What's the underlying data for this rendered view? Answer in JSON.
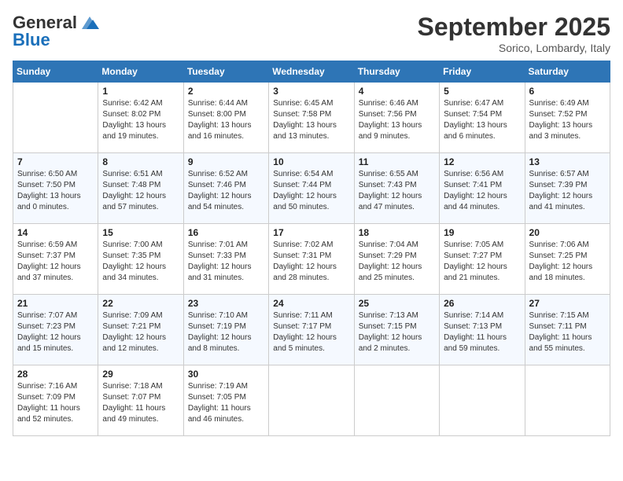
{
  "header": {
    "logo_line1": "General",
    "logo_line2": "Blue",
    "month_title": "September 2025",
    "subtitle": "Sorico, Lombardy, Italy"
  },
  "weekdays": [
    "Sunday",
    "Monday",
    "Tuesday",
    "Wednesday",
    "Thursday",
    "Friday",
    "Saturday"
  ],
  "weeks": [
    [
      {
        "day": "",
        "info": ""
      },
      {
        "day": "1",
        "info": "Sunrise: 6:42 AM\nSunset: 8:02 PM\nDaylight: 13 hours\nand 19 minutes."
      },
      {
        "day": "2",
        "info": "Sunrise: 6:44 AM\nSunset: 8:00 PM\nDaylight: 13 hours\nand 16 minutes."
      },
      {
        "day": "3",
        "info": "Sunrise: 6:45 AM\nSunset: 7:58 PM\nDaylight: 13 hours\nand 13 minutes."
      },
      {
        "day": "4",
        "info": "Sunrise: 6:46 AM\nSunset: 7:56 PM\nDaylight: 13 hours\nand 9 minutes."
      },
      {
        "day": "5",
        "info": "Sunrise: 6:47 AM\nSunset: 7:54 PM\nDaylight: 13 hours\nand 6 minutes."
      },
      {
        "day": "6",
        "info": "Sunrise: 6:49 AM\nSunset: 7:52 PM\nDaylight: 13 hours\nand 3 minutes."
      }
    ],
    [
      {
        "day": "7",
        "info": "Sunrise: 6:50 AM\nSunset: 7:50 PM\nDaylight: 13 hours\nand 0 minutes."
      },
      {
        "day": "8",
        "info": "Sunrise: 6:51 AM\nSunset: 7:48 PM\nDaylight: 12 hours\nand 57 minutes."
      },
      {
        "day": "9",
        "info": "Sunrise: 6:52 AM\nSunset: 7:46 PM\nDaylight: 12 hours\nand 54 minutes."
      },
      {
        "day": "10",
        "info": "Sunrise: 6:54 AM\nSunset: 7:44 PM\nDaylight: 12 hours\nand 50 minutes."
      },
      {
        "day": "11",
        "info": "Sunrise: 6:55 AM\nSunset: 7:43 PM\nDaylight: 12 hours\nand 47 minutes."
      },
      {
        "day": "12",
        "info": "Sunrise: 6:56 AM\nSunset: 7:41 PM\nDaylight: 12 hours\nand 44 minutes."
      },
      {
        "day": "13",
        "info": "Sunrise: 6:57 AM\nSunset: 7:39 PM\nDaylight: 12 hours\nand 41 minutes."
      }
    ],
    [
      {
        "day": "14",
        "info": "Sunrise: 6:59 AM\nSunset: 7:37 PM\nDaylight: 12 hours\nand 37 minutes."
      },
      {
        "day": "15",
        "info": "Sunrise: 7:00 AM\nSunset: 7:35 PM\nDaylight: 12 hours\nand 34 minutes."
      },
      {
        "day": "16",
        "info": "Sunrise: 7:01 AM\nSunset: 7:33 PM\nDaylight: 12 hours\nand 31 minutes."
      },
      {
        "day": "17",
        "info": "Sunrise: 7:02 AM\nSunset: 7:31 PM\nDaylight: 12 hours\nand 28 minutes."
      },
      {
        "day": "18",
        "info": "Sunrise: 7:04 AM\nSunset: 7:29 PM\nDaylight: 12 hours\nand 25 minutes."
      },
      {
        "day": "19",
        "info": "Sunrise: 7:05 AM\nSunset: 7:27 PM\nDaylight: 12 hours\nand 21 minutes."
      },
      {
        "day": "20",
        "info": "Sunrise: 7:06 AM\nSunset: 7:25 PM\nDaylight: 12 hours\nand 18 minutes."
      }
    ],
    [
      {
        "day": "21",
        "info": "Sunrise: 7:07 AM\nSunset: 7:23 PM\nDaylight: 12 hours\nand 15 minutes."
      },
      {
        "day": "22",
        "info": "Sunrise: 7:09 AM\nSunset: 7:21 PM\nDaylight: 12 hours\nand 12 minutes."
      },
      {
        "day": "23",
        "info": "Sunrise: 7:10 AM\nSunset: 7:19 PM\nDaylight: 12 hours\nand 8 minutes."
      },
      {
        "day": "24",
        "info": "Sunrise: 7:11 AM\nSunset: 7:17 PM\nDaylight: 12 hours\nand 5 minutes."
      },
      {
        "day": "25",
        "info": "Sunrise: 7:13 AM\nSunset: 7:15 PM\nDaylight: 12 hours\nand 2 minutes."
      },
      {
        "day": "26",
        "info": "Sunrise: 7:14 AM\nSunset: 7:13 PM\nDaylight: 11 hours\nand 59 minutes."
      },
      {
        "day": "27",
        "info": "Sunrise: 7:15 AM\nSunset: 7:11 PM\nDaylight: 11 hours\nand 55 minutes."
      }
    ],
    [
      {
        "day": "28",
        "info": "Sunrise: 7:16 AM\nSunset: 7:09 PM\nDaylight: 11 hours\nand 52 minutes."
      },
      {
        "day": "29",
        "info": "Sunrise: 7:18 AM\nSunset: 7:07 PM\nDaylight: 11 hours\nand 49 minutes."
      },
      {
        "day": "30",
        "info": "Sunrise: 7:19 AM\nSunset: 7:05 PM\nDaylight: 11 hours\nand 46 minutes."
      },
      {
        "day": "",
        "info": ""
      },
      {
        "day": "",
        "info": ""
      },
      {
        "day": "",
        "info": ""
      },
      {
        "day": "",
        "info": ""
      }
    ]
  ]
}
